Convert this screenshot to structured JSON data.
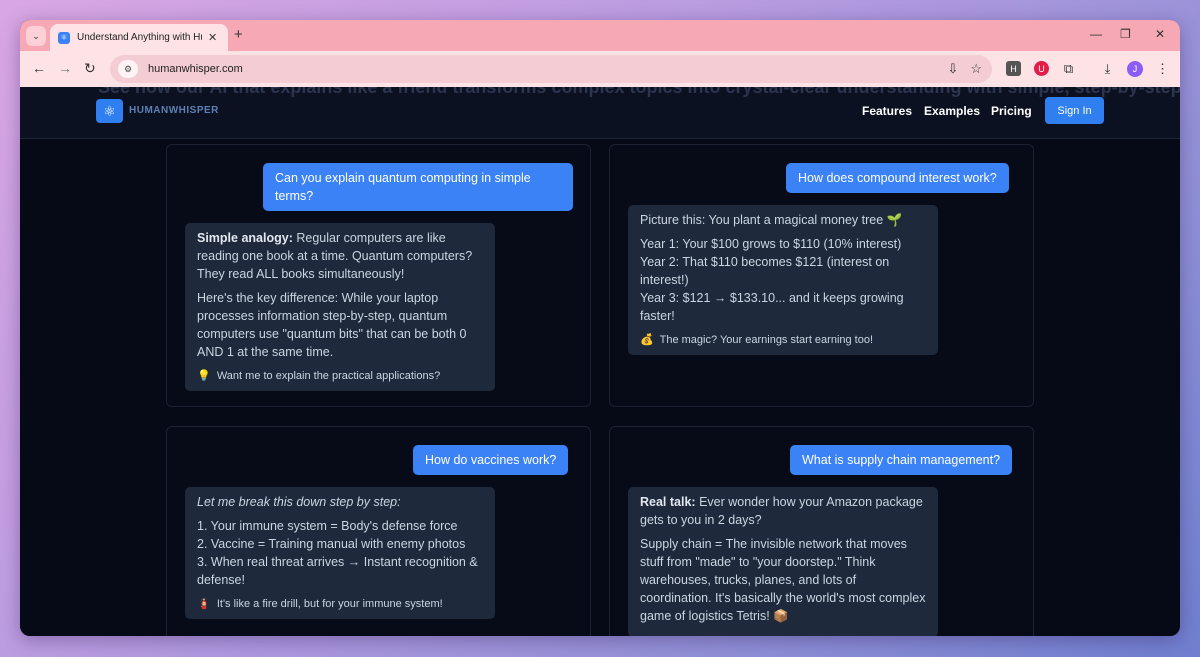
{
  "browser": {
    "tab_title": "Understand Anything with Hum",
    "url": "humanwhisper.com",
    "profile_initial": "J",
    "ext_h": "H"
  },
  "site": {
    "ghost_heading": "See how our AI that explains like a friend transforms complex topics into crystal-clear understanding with simple, step-by-step explanations",
    "logo_text": "HUMANWHISPER",
    "nav": [
      "Features",
      "Examples",
      "Pricing"
    ],
    "sign_in": "Sign In"
  },
  "cards": [
    {
      "question": "Can you explain quantum computing in simple terms?",
      "answer_bold": "Simple analogy:",
      "answer_p1": "Regular computers are like reading one book at a time. Quantum computers? They read ALL books simultaneously!",
      "answer_p2": "Here's the key difference: While your laptop processes information step-by-step, quantum computers use \"quantum bits\" that can be both 0 AND 1 at the same time.",
      "tip_icon": "💡",
      "tip": "Want me to explain the practical applications?"
    },
    {
      "question": "How does compound interest work?",
      "answer_p1": "Picture this: You plant a magical money tree 🌱",
      "answer_p2": "Year 1: Your $100 grows to $110 (10% interest)",
      "answer_p3": "Year 2: That $110 becomes $121 (interest on interest!)",
      "answer_p4": "Year 3: $121 → $133.10... and it keeps growing faster!",
      "tip_icon": "💰",
      "tip": "The magic? Your earnings start earning too!"
    },
    {
      "question": "How do vaccines work?",
      "answer_intro": "Let me break this down step by step:",
      "steps": [
        "1. Your immune system = Body's defense force",
        "2. Vaccine = Training manual with enemy photos",
        "3. When real threat arrives → Instant recognition & defense!"
      ],
      "tip_icon": "🧯",
      "tip": "It's like a fire drill, but for your immune system!"
    },
    {
      "question": "What is supply chain management?",
      "answer_bold": "Real talk:",
      "answer_p1": "Ever wonder how your Amazon package gets to you in 2 days?",
      "answer_p2": "Supply chain = The invisible network that moves stuff from \"made\" to \"your doorstep.\" Think warehouses, trucks, planes, and lots of coordination. It's basically the world's most complex game of logistics Tetris! 📦"
    }
  ]
}
